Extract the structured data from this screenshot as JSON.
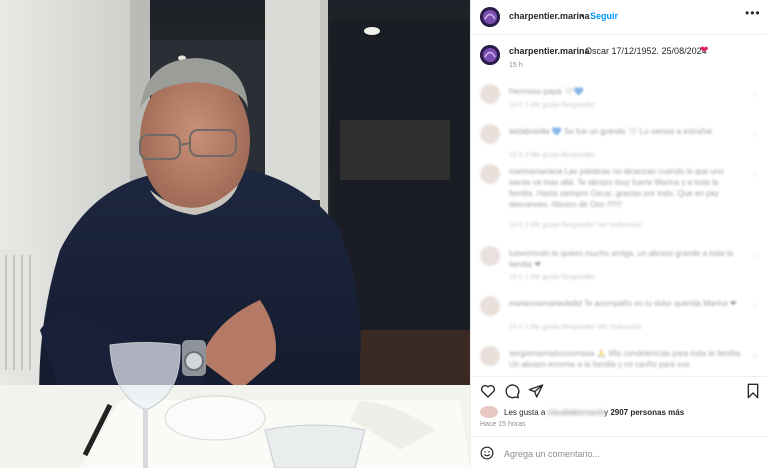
{
  "post": {
    "username": "charpentier.marina",
    "separator": "•",
    "follow_label": "Seguir",
    "more_icon": "more-horizontal-icon",
    "caption": {
      "username": "charpentier.marina",
      "text": "Oscar 17/12/1952. 25/08/2024",
      "emoji": "❤",
      "time": "15 h"
    },
    "likes": {
      "prefix": "Les gusta a",
      "hidden_name": "claudiaborrascb",
      "suffix": "y",
      "count_text": "2907 personas más"
    },
    "posted_ago": "Hace 15 horas",
    "add_comment_placeholder": "Agrega un comentario..."
  },
  "comments": [
    {
      "text": "Hermoso papá 🤍💙",
      "meta": "15 h  1 Me gusta  Responder"
    },
    {
      "text": "laidabotella 💙 Se fue un grande 🤍 Lo vamos a extrañar",
      "meta": "15 h  3 Me gusta  Responder"
    },
    {
      "text": "marinamariana Las palabras no alcanzan cuando lo que uno siente va mas allá. Te abrazo muy fuerte Marina y a toda la familia. Hasta siempre Oscar, gracias por todo. Que en paz descanses. Abrazo de Oso !!!!!!!",
      "meta": "15 h  2 Me gusta  Responder  Ver traducción"
    },
    {
      "text": "luisemmolo te quiero mucho amiga, un abrazo grande a toda la familia ❤",
      "meta": "15 h  1 Me gusta  Responder"
    },
    {
      "text": "mariannamariavbdtd Te acompaño en tu dolor querida Marina ❤",
      "meta": "15 h  1 Me gusta  Responder  Ver traducción"
    },
    {
      "text": "sergiomamadozusmaaa 🙏 Mis condolencias para toda la familia. Un abrazo enorme a la familia y mi cariño para vos",
      "meta": ""
    }
  ]
}
